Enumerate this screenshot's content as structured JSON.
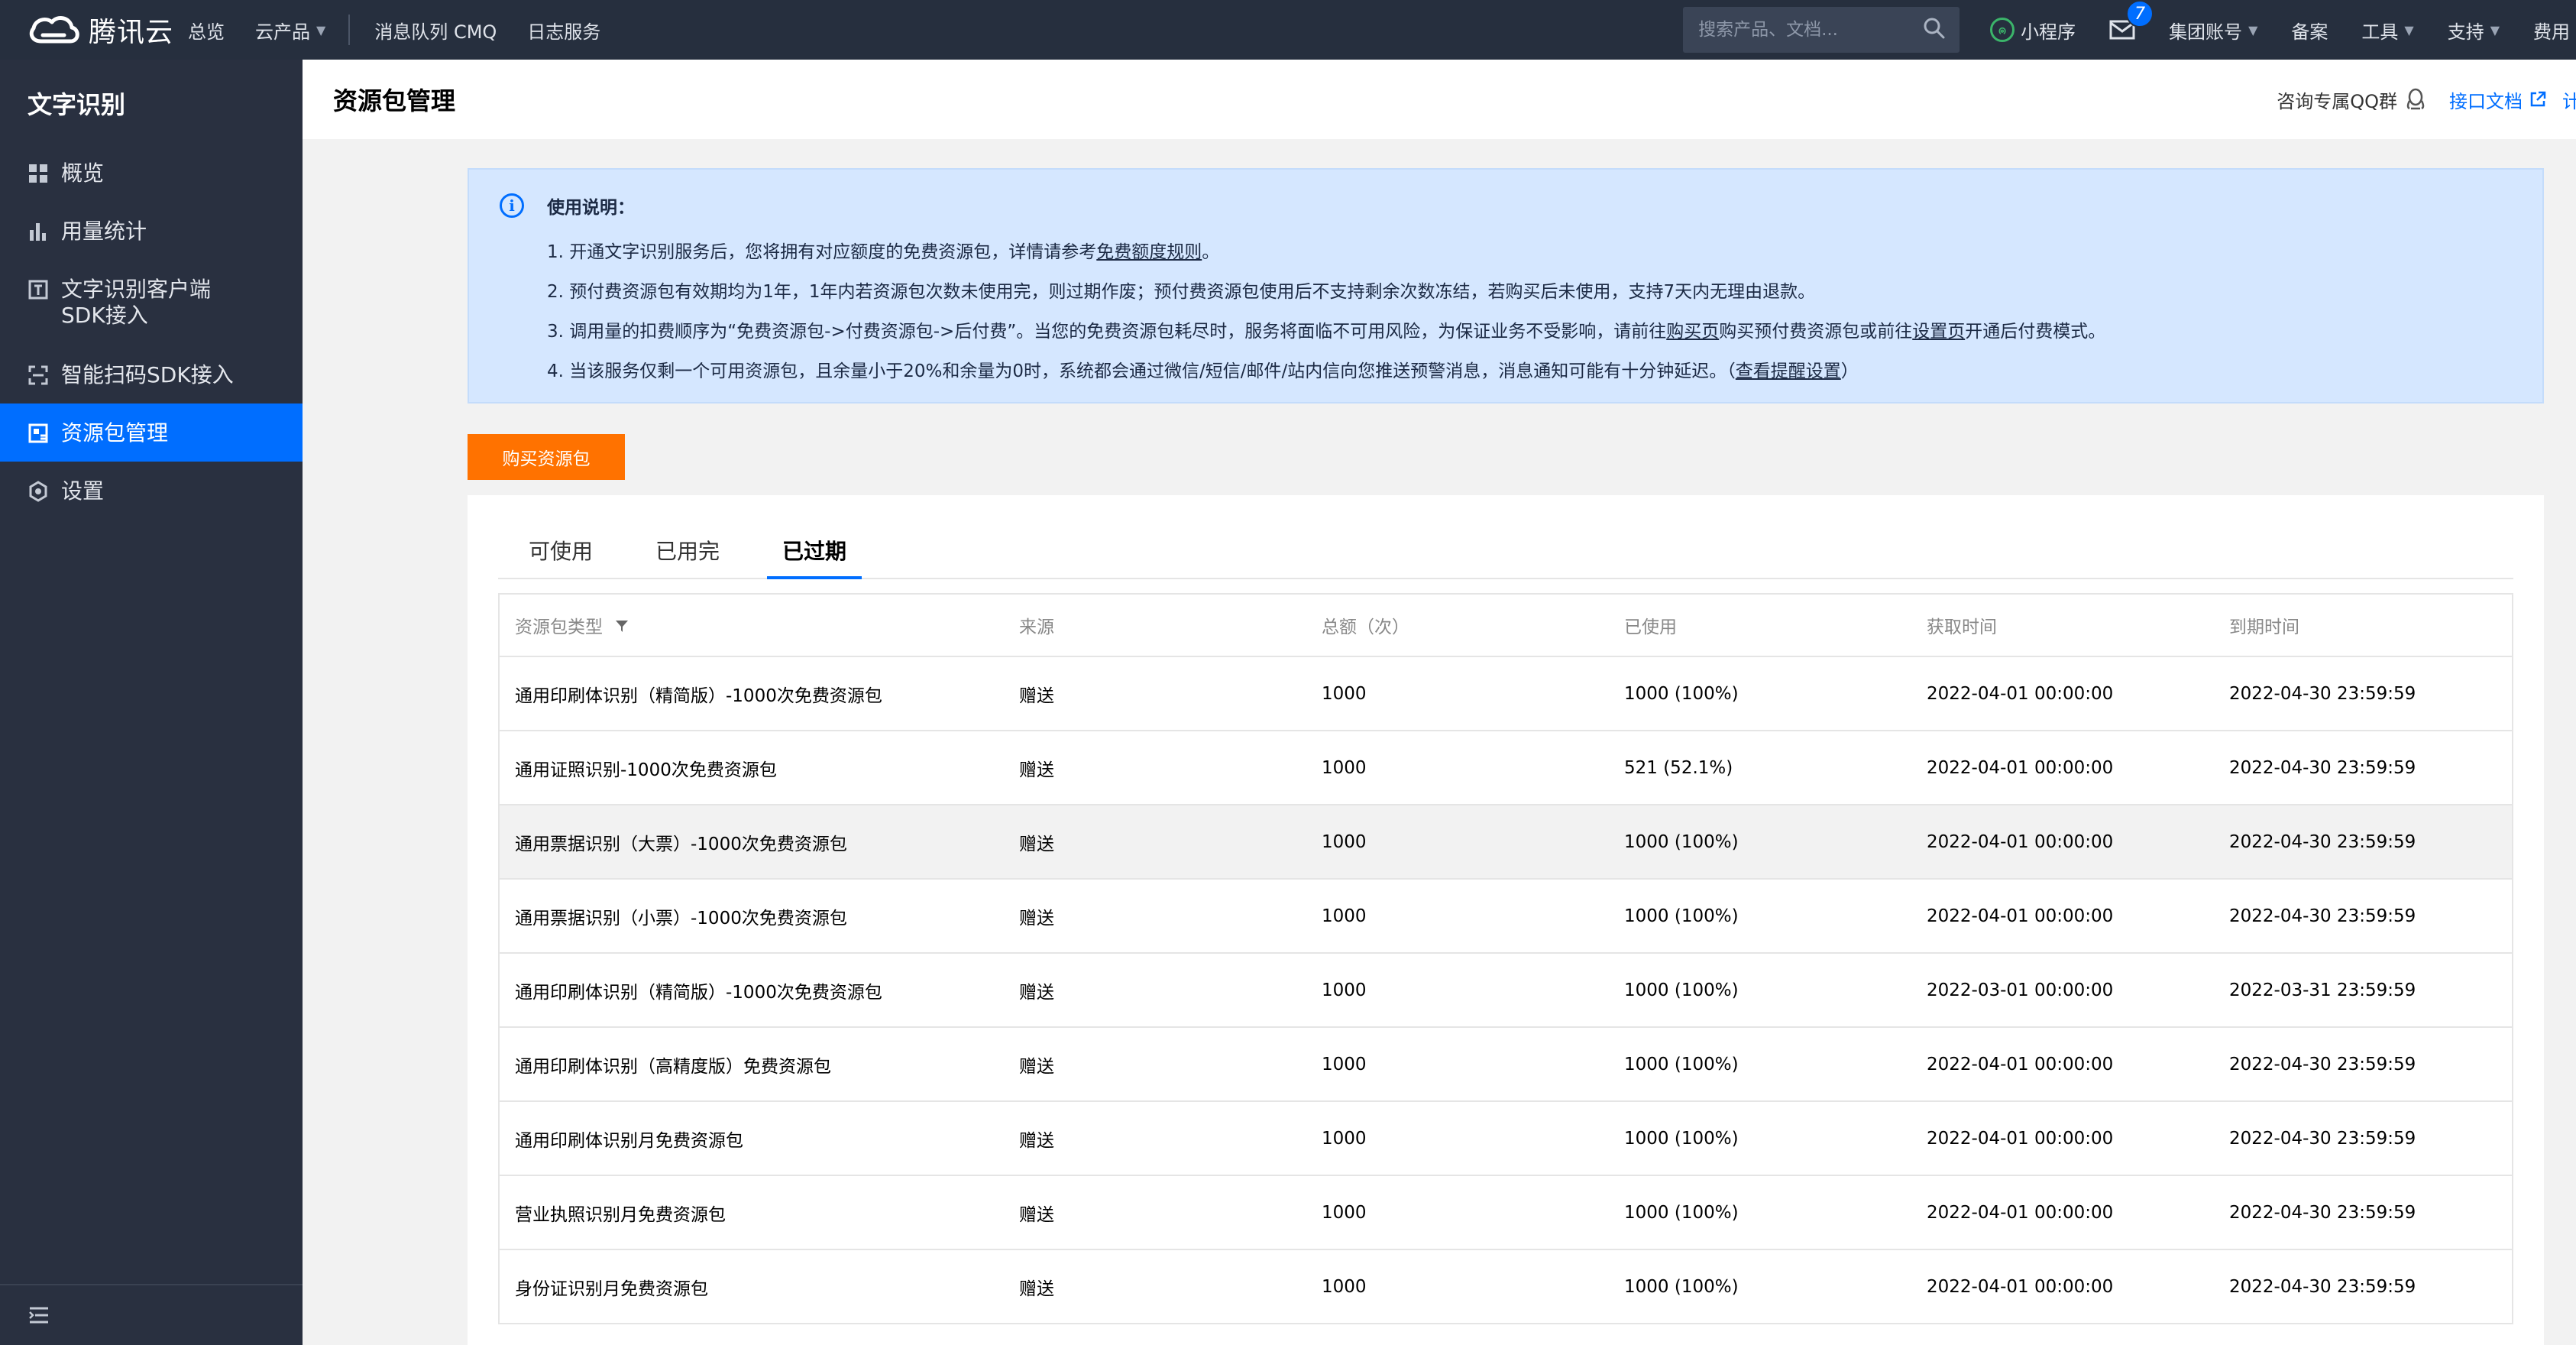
{
  "topbar": {
    "brand": "腾讯云",
    "nav": [
      {
        "label": "总览"
      },
      {
        "label": "云产品"
      },
      {
        "label": "消息队列 CMQ"
      },
      {
        "label": "日志服务"
      }
    ],
    "search_placeholder": "搜索产品、文档...",
    "mini_program": "小程序",
    "mail_count": "7",
    "account": "集团账号",
    "beian": "备案",
    "tools": "工具",
    "support": "支持",
    "billing": "费用"
  },
  "sidebar": {
    "title": "文字识别",
    "items": [
      {
        "label": "概览",
        "icon": "grid-icon"
      },
      {
        "label": "用量统计",
        "icon": "bar-chart-icon"
      },
      {
        "label": "文字识别客户端\nSDK接入",
        "icon": "text-box-icon"
      },
      {
        "label": "智能扫码SDK接入",
        "icon": "scan-icon"
      },
      {
        "label": "资源包管理",
        "icon": "package-icon",
        "active": true
      },
      {
        "label": "设置",
        "icon": "settings-icon"
      }
    ]
  },
  "header": {
    "title": "资源包管理",
    "qq_group": "咨询专属QQ群",
    "api_doc": "接口文档",
    "more": "计"
  },
  "notice": {
    "title": "使用说明：",
    "line1_pre": "1. 开通文字识别服务后，您将拥有对应额度的免费资源包，详情请参考",
    "line1_link": "免费额度规则",
    "line1_post": "。",
    "line2": "2. 预付费资源包有效期均为1年，1年内若资源包次数未使用完，则过期作废；预付费资源包使用后不支持剩余次数冻结，若购买后未使用，支持7天内无理由退款。",
    "line3_pre": "3. 调用量的扣费顺序为“免费资源包->付费资源包->后付费”。当您的免费资源包耗尽时，服务将面临不可用风险，为保证业务不受影响，请前往",
    "line3_link1": "购买页",
    "line3_mid": "购买预付费资源包或前往",
    "line3_link2": "设置页",
    "line3_post": "开通后付费模式。",
    "line4_pre": "4. 当该服务仅剩一个可用资源包，且余量小于20%和余量为0时，系统都会通过微信/短信/邮件/站内信向您推送预警消息，消息通知可能有十分钟延迟。（",
    "line4_link": "查看提醒设置",
    "line4_post": "）"
  },
  "buy_button": "购买资源包",
  "tabs": [
    {
      "label": "可使用"
    },
    {
      "label": "已用完"
    },
    {
      "label": "已过期",
      "active": true
    }
  ],
  "table": {
    "headers": [
      "资源包类型",
      "来源",
      "总额（次）",
      "已使用",
      "获取时间",
      "到期时间"
    ],
    "rows": [
      [
        "通用印刷体识别（精简版）-1000次免费资源包",
        "赠送",
        "1000",
        "1000 (100%)",
        "2022-04-01 00:00:00",
        "2022-04-30 23:59:59"
      ],
      [
        "通用证照识别-1000次免费资源包",
        "赠送",
        "1000",
        "521 (52.1%)",
        "2022-04-01 00:00:00",
        "2022-04-30 23:59:59"
      ],
      [
        "通用票据识别（大票）-1000次免费资源包",
        "赠送",
        "1000",
        "1000 (100%)",
        "2022-04-01 00:00:00",
        "2022-04-30 23:59:59"
      ],
      [
        "通用票据识别（小票）-1000次免费资源包",
        "赠送",
        "1000",
        "1000 (100%)",
        "2022-04-01 00:00:00",
        "2022-04-30 23:59:59"
      ],
      [
        "通用印刷体识别（精简版）-1000次免费资源包",
        "赠送",
        "1000",
        "1000 (100%)",
        "2022-03-01 00:00:00",
        "2022-03-31 23:59:59"
      ],
      [
        "通用印刷体识别（高精度版）免费资源包",
        "赠送",
        "1000",
        "1000 (100%)",
        "2022-04-01 00:00:00",
        "2022-04-30 23:59:59"
      ],
      [
        "通用印刷体识别月免费资源包",
        "赠送",
        "1000",
        "1000 (100%)",
        "2022-04-01 00:00:00",
        "2022-04-30 23:59:59"
      ],
      [
        "营业执照识别月免费资源包",
        "赠送",
        "1000",
        "1000 (100%)",
        "2022-04-01 00:00:00",
        "2022-04-30 23:59:59"
      ],
      [
        "身份证识别月免费资源包",
        "赠送",
        "1000",
        "1000 (100%)",
        "2022-04-01 00:00:00",
        "2022-04-30 23:59:59"
      ]
    ]
  }
}
